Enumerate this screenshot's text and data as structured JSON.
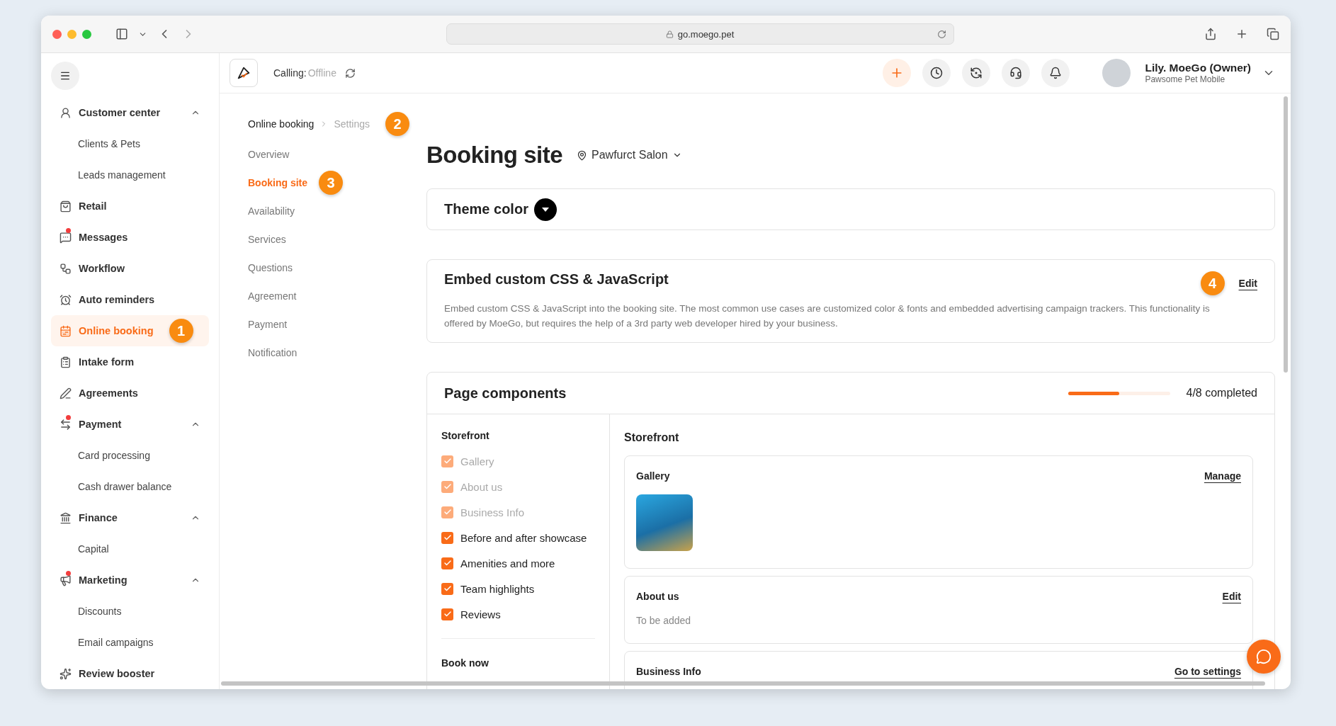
{
  "browser": {
    "url": "go.moego.pet"
  },
  "topbar": {
    "calling_label": "Calling:",
    "calling_status": "Offline",
    "user_name": "Lily. MoeGo (Owner)",
    "user_business": "Pawsome Pet Mobile"
  },
  "sidebar": {
    "items": [
      {
        "label": "Customer center",
        "selected": false,
        "dot": false,
        "expanded": true,
        "children": [
          {
            "label": "Clients & Pets",
            "selected": false
          },
          {
            "label": "Leads management",
            "selected": false
          }
        ]
      },
      {
        "label": "Retail",
        "selected": false,
        "dot": false
      },
      {
        "label": "Messages",
        "selected": false,
        "dot": true
      },
      {
        "label": "Workflow",
        "selected": false,
        "dot": false
      },
      {
        "label": "Auto reminders",
        "selected": false,
        "dot": false
      },
      {
        "label": "Online booking",
        "selected": true,
        "dot": false,
        "callout": "1"
      },
      {
        "label": "Intake form",
        "selected": false,
        "dot": false
      },
      {
        "label": "Agreements",
        "selected": false,
        "dot": false
      },
      {
        "label": "Payment",
        "selected": false,
        "dot": true,
        "expanded": true,
        "children": [
          {
            "label": "Card processing",
            "selected": false
          },
          {
            "label": "Cash drawer balance",
            "selected": false
          }
        ]
      },
      {
        "label": "Finance",
        "selected": false,
        "dot": false,
        "expanded": true,
        "children": [
          {
            "label": "Capital",
            "selected": false
          }
        ]
      },
      {
        "label": "Marketing",
        "selected": false,
        "dot": true,
        "expanded": true,
        "children": [
          {
            "label": "Discounts",
            "selected": false
          },
          {
            "label": "Email campaigns",
            "selected": false
          }
        ]
      },
      {
        "label": "Review booster",
        "selected": false,
        "dot": false
      }
    ]
  },
  "breadcrumb": {
    "items": [
      "Online booking",
      "Settings"
    ],
    "callout": "2"
  },
  "settings_nav": [
    {
      "label": "Overview",
      "selected": false
    },
    {
      "label": "Booking site",
      "selected": true,
      "callout": "3"
    },
    {
      "label": "Availability",
      "selected": false
    },
    {
      "label": "Services",
      "selected": false
    },
    {
      "label": "Questions",
      "selected": false
    },
    {
      "label": "Agreement",
      "selected": false
    },
    {
      "label": "Payment",
      "selected": false
    },
    {
      "label": "Notification",
      "selected": false
    }
  ],
  "page": {
    "title": "Booking site",
    "location": "Pawfurct Salon"
  },
  "theme_color": {
    "title": "Theme color"
  },
  "embed": {
    "title": "Embed custom CSS & JavaScript",
    "description": "Embed custom CSS & JavaScript into the booking site. The most common use cases are customized color & fonts and embedded advertising campaign trackers. This functionality is offered by MoeGo, but requires the help of a 3rd party web developer hired by your business.",
    "action": "Edit",
    "callout": "4"
  },
  "components": {
    "title": "Page components",
    "level": 0.5,
    "progress_text": "4/8 completed",
    "groups": [
      {
        "title": "Storefront",
        "items": [
          {
            "label": "Gallery",
            "checked": true,
            "disabled": true
          },
          {
            "label": "About us",
            "checked": true,
            "disabled": true
          },
          {
            "label": "Business Info",
            "checked": true,
            "disabled": true
          },
          {
            "label": "Before and after showcase",
            "checked": true,
            "disabled": false
          },
          {
            "label": "Amenities and more",
            "checked": true,
            "disabled": false
          },
          {
            "label": "Team highlights",
            "checked": true,
            "disabled": false
          },
          {
            "label": "Reviews",
            "checked": true,
            "disabled": false
          }
        ]
      },
      {
        "title": "Book now"
      }
    ],
    "preview": {
      "title": "Storefront",
      "sections": [
        {
          "kind": "gallery",
          "title": "Gallery",
          "action": "Manage"
        },
        {
          "kind": "text",
          "title": "About us",
          "action": "Edit",
          "text": "To be added"
        },
        {
          "kind": "plain",
          "title": "Business Info",
          "action": "Go to settings"
        }
      ]
    }
  }
}
